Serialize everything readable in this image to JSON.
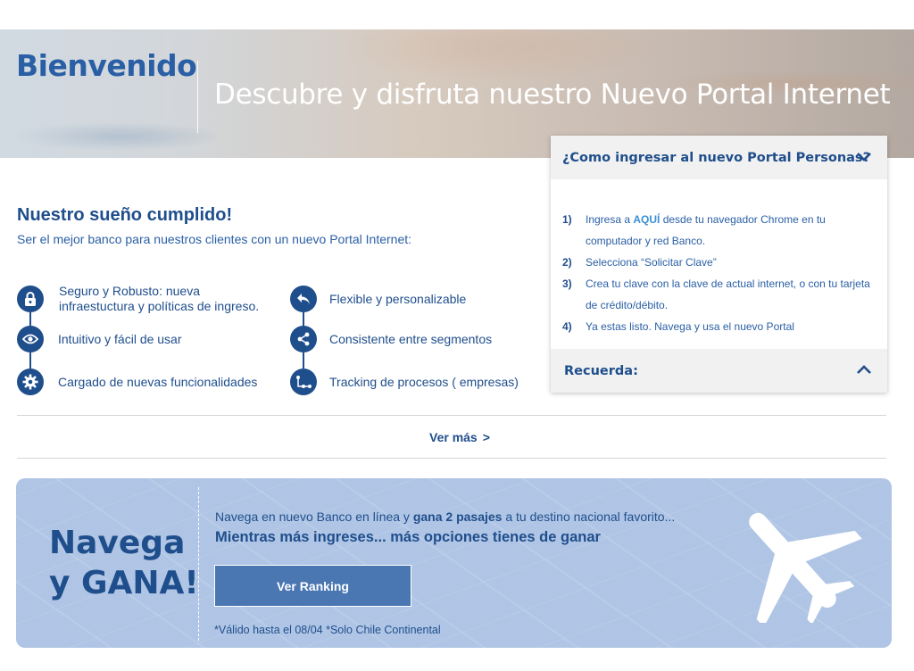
{
  "hero": {
    "title": "Bienvenido",
    "subtitle": "Descubre y disfruta nuestro Nuevo Portal Internet"
  },
  "intro": {
    "title": "Nuestro sueño cumplido!",
    "subtitle": "Ser el mejor banco para nuestros clientes con un nuevo Portal Internet:"
  },
  "features": {
    "left": [
      {
        "icon": "lock-icon",
        "label": "Seguro y Robusto: nueva infraestuctura y políticas de ingreso."
      },
      {
        "icon": "eye-icon",
        "label": "Intuitivo y fácil de usar"
      },
      {
        "icon": "gear-icon",
        "label": "Cargado de nuevas funcionalidades"
      }
    ],
    "right": [
      {
        "icon": "reply-arrow-icon",
        "label": "Flexible y personalizable"
      },
      {
        "icon": "share-nodes-icon",
        "label": "Consistente entre segmentos"
      },
      {
        "icon": "tracking-icon",
        "label": "Tracking de procesos ( empresas)"
      }
    ]
  },
  "ver_mas": {
    "label": "Ver más",
    "chevron": ">"
  },
  "panel": {
    "header": "¿Como ingresar al nuevo Portal Personas?",
    "steps": [
      {
        "num": "1)",
        "pre": "Ingresa a ",
        "link": "AQUÍ",
        "post": " desde tu navegador Chrome en  tu computador y red Banco."
      },
      {
        "num": "2)",
        "text": "Selecciona “Solicitar Clave”"
      },
      {
        "num": "3)",
        "text": "Crea tu clave con la clave de actual internet, o  con tu tarjeta de crédito/débito."
      },
      {
        "num": "4)",
        "text": "Ya estas listo. Navega y usa el nuevo Portal"
      }
    ],
    "footer": "Recuerda:"
  },
  "banner": {
    "title_line1": "Navega",
    "title_line2": "y GANA!",
    "line1_pre": "Navega en nuevo Banco en línea y ",
    "line1_bold": "gana 2 pasajes",
    "line1_post": " a tu destino nacional favorito...",
    "line2": "Mientras más ingreses... más opciones tienes de ganar",
    "button": "Ver Ranking",
    "note": "*Válido hasta el 08/04 *Solo Chile Continental"
  },
  "colors": {
    "primary": "#1f4e8c",
    "accent": "#2a5fa5",
    "link": "#3a8fd6",
    "button": "#4a76b2",
    "banner_bg": "#aac2e4"
  }
}
